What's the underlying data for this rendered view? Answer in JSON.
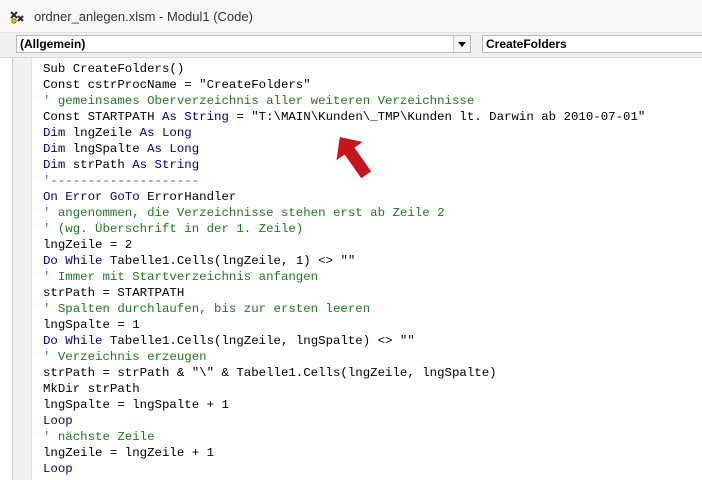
{
  "window": {
    "title": "ordner_anlegen.xlsm - Modul1 (Code)"
  },
  "toolbar": {
    "object_combo": "(Allgemein)",
    "procedure_combo": "CreateFolders"
  },
  "code_lines": [
    [
      [
        "t",
        "Sub CreateFolders()"
      ]
    ],
    [
      [
        "t",
        "Const cstrProcName = \"CreateFolders\""
      ]
    ],
    [
      [
        "c",
        "' gemeinsames Oberverzeichnis aller weiteren Verzeichnisse"
      ]
    ],
    [
      [
        "t",
        "Const STARTPATH "
      ],
      [
        "k",
        "As"
      ],
      [
        "t",
        " "
      ],
      [
        "k",
        "String"
      ],
      [
        "t",
        " = \"T:\\MAIN\\Kunden\\_TMP\\Kunden lt. Darwin ab 2010-07-01\""
      ]
    ],
    [
      [
        "k",
        "Dim"
      ],
      [
        "t",
        " lngZeile "
      ],
      [
        "k",
        "As"
      ],
      [
        "t",
        " "
      ],
      [
        "k",
        "Long"
      ]
    ],
    [
      [
        "k",
        "Dim"
      ],
      [
        "t",
        " lngSpalte "
      ],
      [
        "k",
        "As"
      ],
      [
        "t",
        " "
      ],
      [
        "k",
        "Long"
      ]
    ],
    [
      [
        "k",
        "Dim"
      ],
      [
        "t",
        " strPath "
      ],
      [
        "k",
        "As"
      ],
      [
        "t",
        " "
      ],
      [
        "k",
        "String"
      ]
    ],
    [
      [
        "c",
        "'--------------------"
      ]
    ],
    [
      [
        "k",
        "On Error GoTo"
      ],
      [
        "t",
        " ErrorHandler"
      ]
    ],
    [
      [
        "c",
        "' angenommen, die Verzeichnisse stehen erst ab Zeile 2"
      ]
    ],
    [
      [
        "c",
        "' (wg. Überschrift in der 1. Zeile)"
      ]
    ],
    [
      [
        "t",
        "lngZeile = 2"
      ]
    ],
    [
      [
        "k",
        "Do While"
      ],
      [
        "t",
        " Tabelle1.Cells(lngZeile, 1) <> \"\""
      ]
    ],
    [
      [
        "c",
        "' Immer mit Startverzeichnis anfangen"
      ]
    ],
    [
      [
        "t",
        "strPath = STARTPATH"
      ]
    ],
    [
      [
        "c",
        "' Spalten durchlaufen, bis zur ersten leeren"
      ]
    ],
    [
      [
        "t",
        "lngSpalte = 1"
      ]
    ],
    [
      [
        "k",
        "Do While"
      ],
      [
        "t",
        " Tabelle1.Cells(lngZeile, lngSpalte) <> \"\""
      ]
    ],
    [
      [
        "c",
        "' Verzeichnis erzeugen"
      ]
    ],
    [
      [
        "t",
        "strPath = strPath & \"\\\" & Tabelle1.Cells(lngZeile, lngSpalte)"
      ]
    ],
    [
      [
        "t",
        "MkDir strPath"
      ]
    ],
    [
      [
        "t",
        "lngSpalte = lngSpalte + 1"
      ]
    ],
    [
      [
        "k",
        "Loop"
      ]
    ],
    [
      [
        "c",
        "' nächste Zeile"
      ]
    ],
    [
      [
        "t",
        "lngZeile = lngZeile + 1"
      ]
    ],
    [
      [
        "k",
        "Loop"
      ]
    ]
  ],
  "colors": {
    "keyword": "#00008b",
    "comment": "#1e7a1e",
    "arrow": "#c8141e"
  },
  "icons": {
    "app": "vba-code-icon",
    "annotation": "red-arrow"
  }
}
